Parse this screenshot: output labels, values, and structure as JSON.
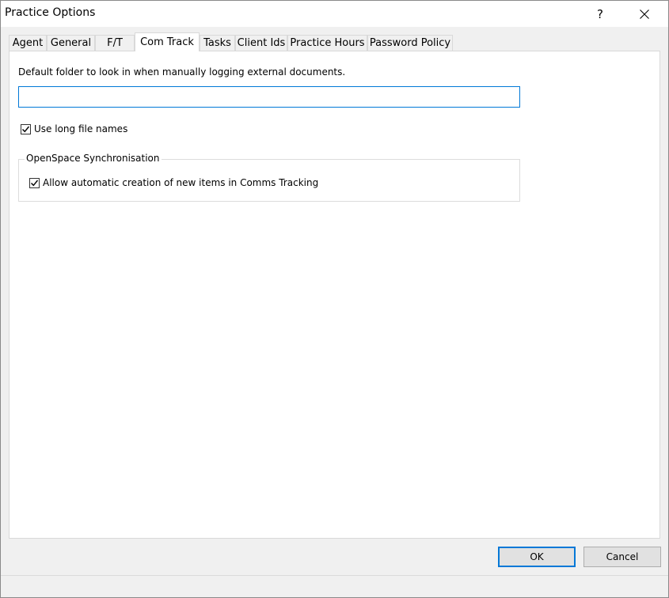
{
  "window": {
    "title": "Practice Options",
    "help_label": "?"
  },
  "tabs": [
    {
      "label": "Agent",
      "active": false
    },
    {
      "label": "General",
      "active": false
    },
    {
      "label": "F/T",
      "active": false
    },
    {
      "label": "Com Track",
      "active": true
    },
    {
      "label": "Tasks",
      "active": false
    },
    {
      "label": "Client Ids",
      "active": false
    },
    {
      "label": "Practice Hours",
      "active": false
    },
    {
      "label": "Password Policy",
      "active": false
    }
  ],
  "com_track": {
    "folder_label": "Default folder to look in when manually logging external documents.",
    "folder_value": "",
    "long_file_names": {
      "label": "Use long file names",
      "checked": true
    },
    "openspace_group": {
      "legend": "OpenSpace Synchronisation",
      "allow_creation": {
        "label": "Allow automatic creation of new items in Comms Tracking",
        "checked": true
      }
    }
  },
  "footer": {
    "ok_label": "OK",
    "cancel_label": "Cancel"
  },
  "colors": {
    "accent": "#0078d7",
    "panel_bg": "#ffffff",
    "window_bg": "#f0f0f0"
  }
}
